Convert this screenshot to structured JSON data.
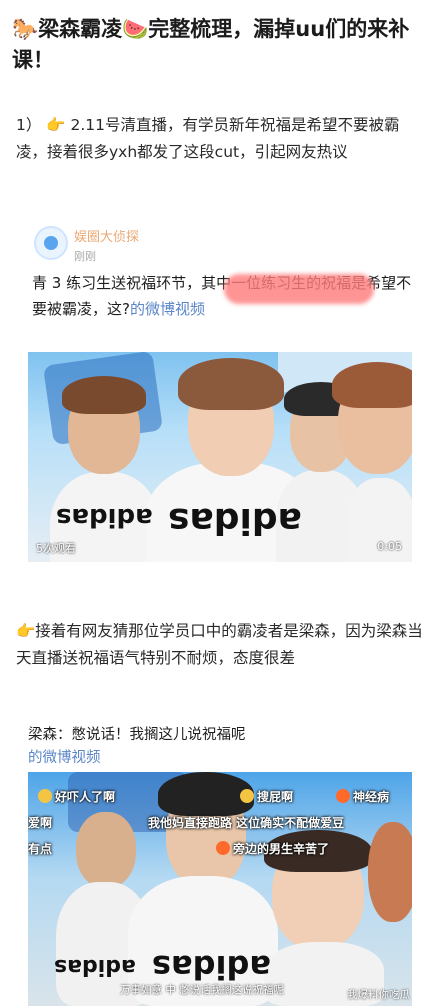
{
  "title": "🐎梁森霸凌🍉完整梳理，漏掉uu们的来补课！",
  "para1": "1） 👉 2.11号清直播，有学员新年祝福是希望不要被霸凌，接着很多yxh都发了这段cut，引起网友热议",
  "card1": {
    "account_name": "娱圈大侦探",
    "time": "刚刚",
    "text": "青 3 练习生送祝福环节，其中一位练习生的祝福是希望不要被霸凌，这?",
    "link": "的微博视频",
    "views": "5次观看",
    "duration": "0:05",
    "shirt_text": "adidas"
  },
  "para2": "👉接着有网友猜那位学员口中的霸凌者是梁森，因为梁森当天直播送祝福语气特别不耐烦，态度很差",
  "card2": {
    "text": "梁森：憋说话！我搁这儿说祝福呢",
    "link": "的微博视频",
    "bullets": [
      "好吓人了啊",
      "搜屁啊",
      "神经病",
      "爱啊",
      "我他妈直接跑路 这位确实不配做爱豆",
      "有点",
      "旁边的男生辛苦了"
    ],
    "subtitle": "万事如意 中 憋说话我搁这说祝福呢",
    "watermark": "我爆料你吃瓜",
    "shirt_text": "adidas"
  }
}
